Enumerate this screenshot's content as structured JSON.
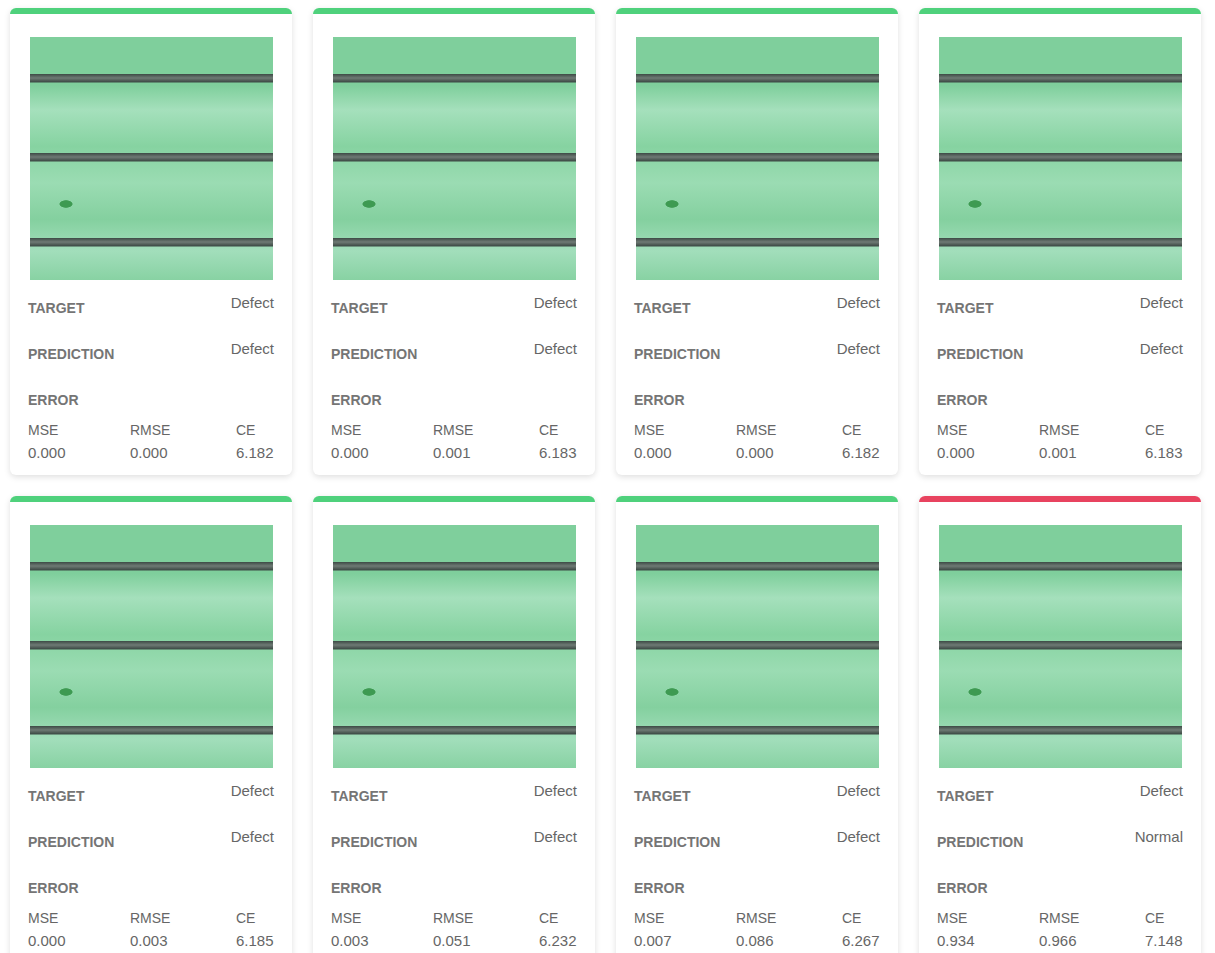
{
  "cards": [
    {
      "color": "#4fd17c",
      "target_label": "TARGET",
      "target": "Defect",
      "prediction_label": "PREDICTION",
      "prediction": "Defect",
      "error_label": "ERROR",
      "metrics": [
        {
          "name": "MSE",
          "value": "0.000"
        },
        {
          "name": "RMSE",
          "value": "0.000"
        },
        {
          "name": "CE",
          "value": "6.182"
        }
      ]
    },
    {
      "color": "#4fd17c",
      "target_label": "TARGET",
      "target": "Defect",
      "prediction_label": "PREDICTION",
      "prediction": "Defect",
      "error_label": "ERROR",
      "metrics": [
        {
          "name": "MSE",
          "value": "0.000"
        },
        {
          "name": "RMSE",
          "value": "0.001"
        },
        {
          "name": "CE",
          "value": "6.183"
        }
      ]
    },
    {
      "color": "#4fd17c",
      "target_label": "TARGET",
      "target": "Defect",
      "prediction_label": "PREDICTION",
      "prediction": "Defect",
      "error_label": "ERROR",
      "metrics": [
        {
          "name": "MSE",
          "value": "0.000"
        },
        {
          "name": "RMSE",
          "value": "0.000"
        },
        {
          "name": "CE",
          "value": "6.182"
        }
      ]
    },
    {
      "color": "#4fd17c",
      "target_label": "TARGET",
      "target": "Defect",
      "prediction_label": "PREDICTION",
      "prediction": "Defect",
      "error_label": "ERROR",
      "metrics": [
        {
          "name": "MSE",
          "value": "0.000"
        },
        {
          "name": "RMSE",
          "value": "0.001"
        },
        {
          "name": "CE",
          "value": "6.183"
        }
      ]
    },
    {
      "color": "#4fd17c",
      "target_label": "TARGET",
      "target": "Defect",
      "prediction_label": "PREDICTION",
      "prediction": "Defect",
      "error_label": "ERROR",
      "metrics": [
        {
          "name": "MSE",
          "value": "0.000"
        },
        {
          "name": "RMSE",
          "value": "0.003"
        },
        {
          "name": "CE",
          "value": "6.185"
        }
      ]
    },
    {
      "color": "#4fd17c",
      "target_label": "TARGET",
      "target": "Defect",
      "prediction_label": "PREDICTION",
      "prediction": "Defect",
      "error_label": "ERROR",
      "metrics": [
        {
          "name": "MSE",
          "value": "0.003"
        },
        {
          "name": "RMSE",
          "value": "0.051"
        },
        {
          "name": "CE",
          "value": "6.232"
        }
      ]
    },
    {
      "color": "#4fd17c",
      "target_label": "TARGET",
      "target": "Defect",
      "prediction_label": "PREDICTION",
      "prediction": "Defect",
      "error_label": "ERROR",
      "metrics": [
        {
          "name": "MSE",
          "value": "0.007"
        },
        {
          "name": "RMSE",
          "value": "0.086"
        },
        {
          "name": "CE",
          "value": "6.267"
        }
      ]
    },
    {
      "color": "#e8435f",
      "target_label": "TARGET",
      "target": "Defect",
      "prediction_label": "PREDICTION",
      "prediction": "Normal",
      "error_label": "ERROR",
      "metrics": [
        {
          "name": "MSE",
          "value": "0.934"
        },
        {
          "name": "RMSE",
          "value": "0.966"
        },
        {
          "name": "CE",
          "value": "7.148"
        }
      ]
    }
  ]
}
